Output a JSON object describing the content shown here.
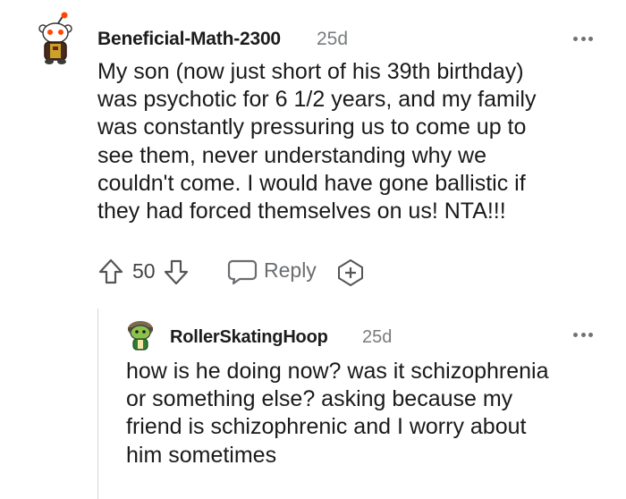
{
  "comment": {
    "username": "Beneficial-Math-2300",
    "timestamp": "25d",
    "lines": [
      "My son (now just short of his 39th birthday)",
      "was psychotic for 6 1/2 years, and my family",
      "was constantly pressuring us to come up to",
      "see them, never understanding why we",
      "couldn't come. I would have gone ballistic if",
      "they had forced themselves on us! NTA!!!"
    ],
    "vote_count": "50",
    "reply_label": "Reply"
  },
  "reply": {
    "username": "RollerSkatingHoop",
    "timestamp": "25d",
    "lines": [
      "how is he doing now? was it schizophrenia",
      "or something else? asking because my",
      "friend is schizophrenic and I worry about",
      "him sometimes"
    ]
  },
  "icons": {
    "upvote": "upvote-arrow-icon",
    "downvote": "downvote-arrow-icon",
    "reply": "speech-bubble-icon",
    "award": "award-plus-icon",
    "more": "more-horizontal-icon"
  },
  "colors": {
    "text": "#1a1a1b",
    "meta": "#787c7e",
    "thread_line": "#d6d6d6"
  }
}
